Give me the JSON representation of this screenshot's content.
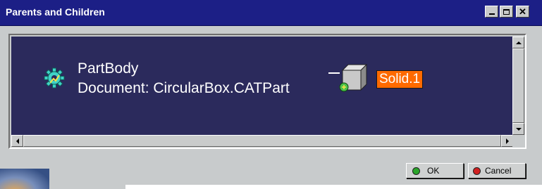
{
  "window": {
    "title": "Parents and Children",
    "controls": [
      "minimize-icon",
      "maximize-icon",
      "close-icon"
    ]
  },
  "graph": {
    "parent_node": {
      "icon": "part-body-gear-icon",
      "line1": "PartBody",
      "line2": "Document: CircularBox.CATPart"
    },
    "child_node": {
      "icon": "solid-cube-icon",
      "label": "Solid.1",
      "highlight_color": "#ff6a00"
    },
    "background_color": "#2b2a5c"
  },
  "buttons": {
    "ok_label": "OK",
    "cancel_label": "Cancel",
    "ok_color": "#2aa52a",
    "cancel_color": "#d12020"
  }
}
